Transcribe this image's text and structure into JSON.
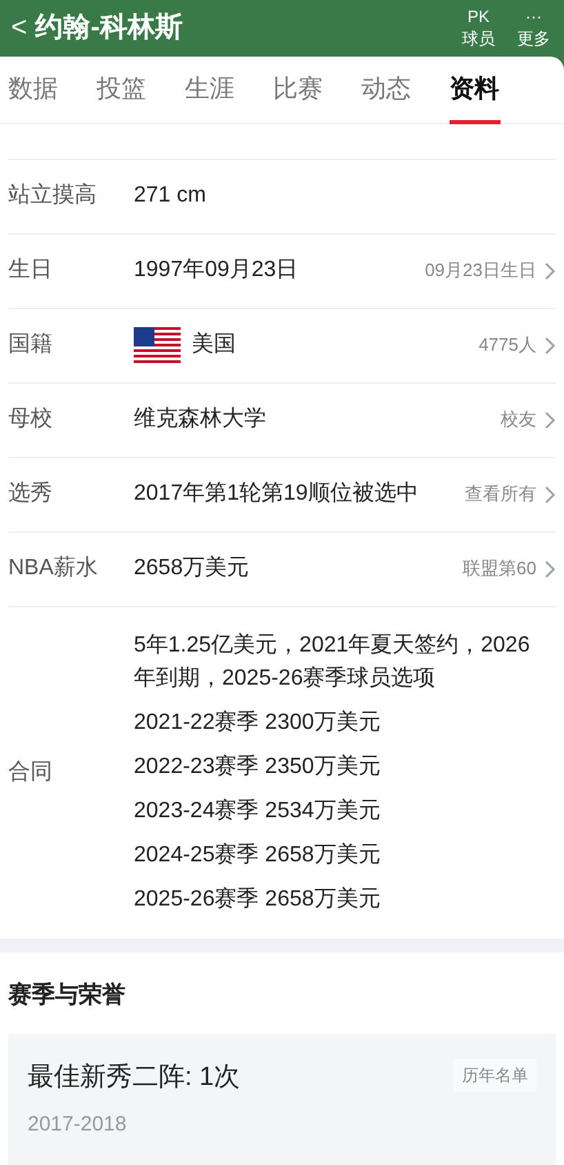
{
  "header": {
    "back": "<",
    "title": "约翰-科林斯",
    "actions": [
      {
        "icon": "PK",
        "label": "球员"
      },
      {
        "icon": "···",
        "label": "更多"
      }
    ]
  },
  "tabs": [
    {
      "label": "数据",
      "selected": false
    },
    {
      "label": "投篮",
      "selected": false
    },
    {
      "label": "生涯",
      "selected": false
    },
    {
      "label": "比赛",
      "selected": false
    },
    {
      "label": "动态",
      "selected": false
    },
    {
      "label": "资料",
      "selected": true
    }
  ],
  "rows": [
    {
      "label": "站立摸高",
      "value": "271 cm",
      "link": false
    },
    {
      "label": "生日",
      "value": "1997年09月23日",
      "extra": "09月23日生日",
      "link": true
    },
    {
      "label": "国籍",
      "value": "美国",
      "flag": true,
      "extra": "4775人",
      "link": true
    },
    {
      "label": "母校",
      "value": "维克森林大学",
      "extra": "校友",
      "link": true
    },
    {
      "label": "选秀",
      "value": "2017年第1轮第19顺位被选中",
      "extra": "查看所有",
      "link": true
    },
    {
      "label": "NBA薪水",
      "value": "2658万美元",
      "extra": "联盟第60",
      "link": true
    }
  ],
  "contract": {
    "label": "合同",
    "lines": [
      "5年1.25亿美元，2021年夏天签约，2026年到期，2025-26赛季球员选项",
      "2021-22赛季 2300万美元",
      "2022-23赛季 2350万美元",
      "2023-24赛季 2534万美元",
      "2024-25赛季 2658万美元",
      "2025-26赛季 2658万美元"
    ]
  },
  "honors": {
    "title": "赛季与荣誉",
    "items": [
      {
        "name": "最佳新秀二阵: 1次",
        "button": "历年名单",
        "seasons": "2017-2018"
      }
    ]
  }
}
